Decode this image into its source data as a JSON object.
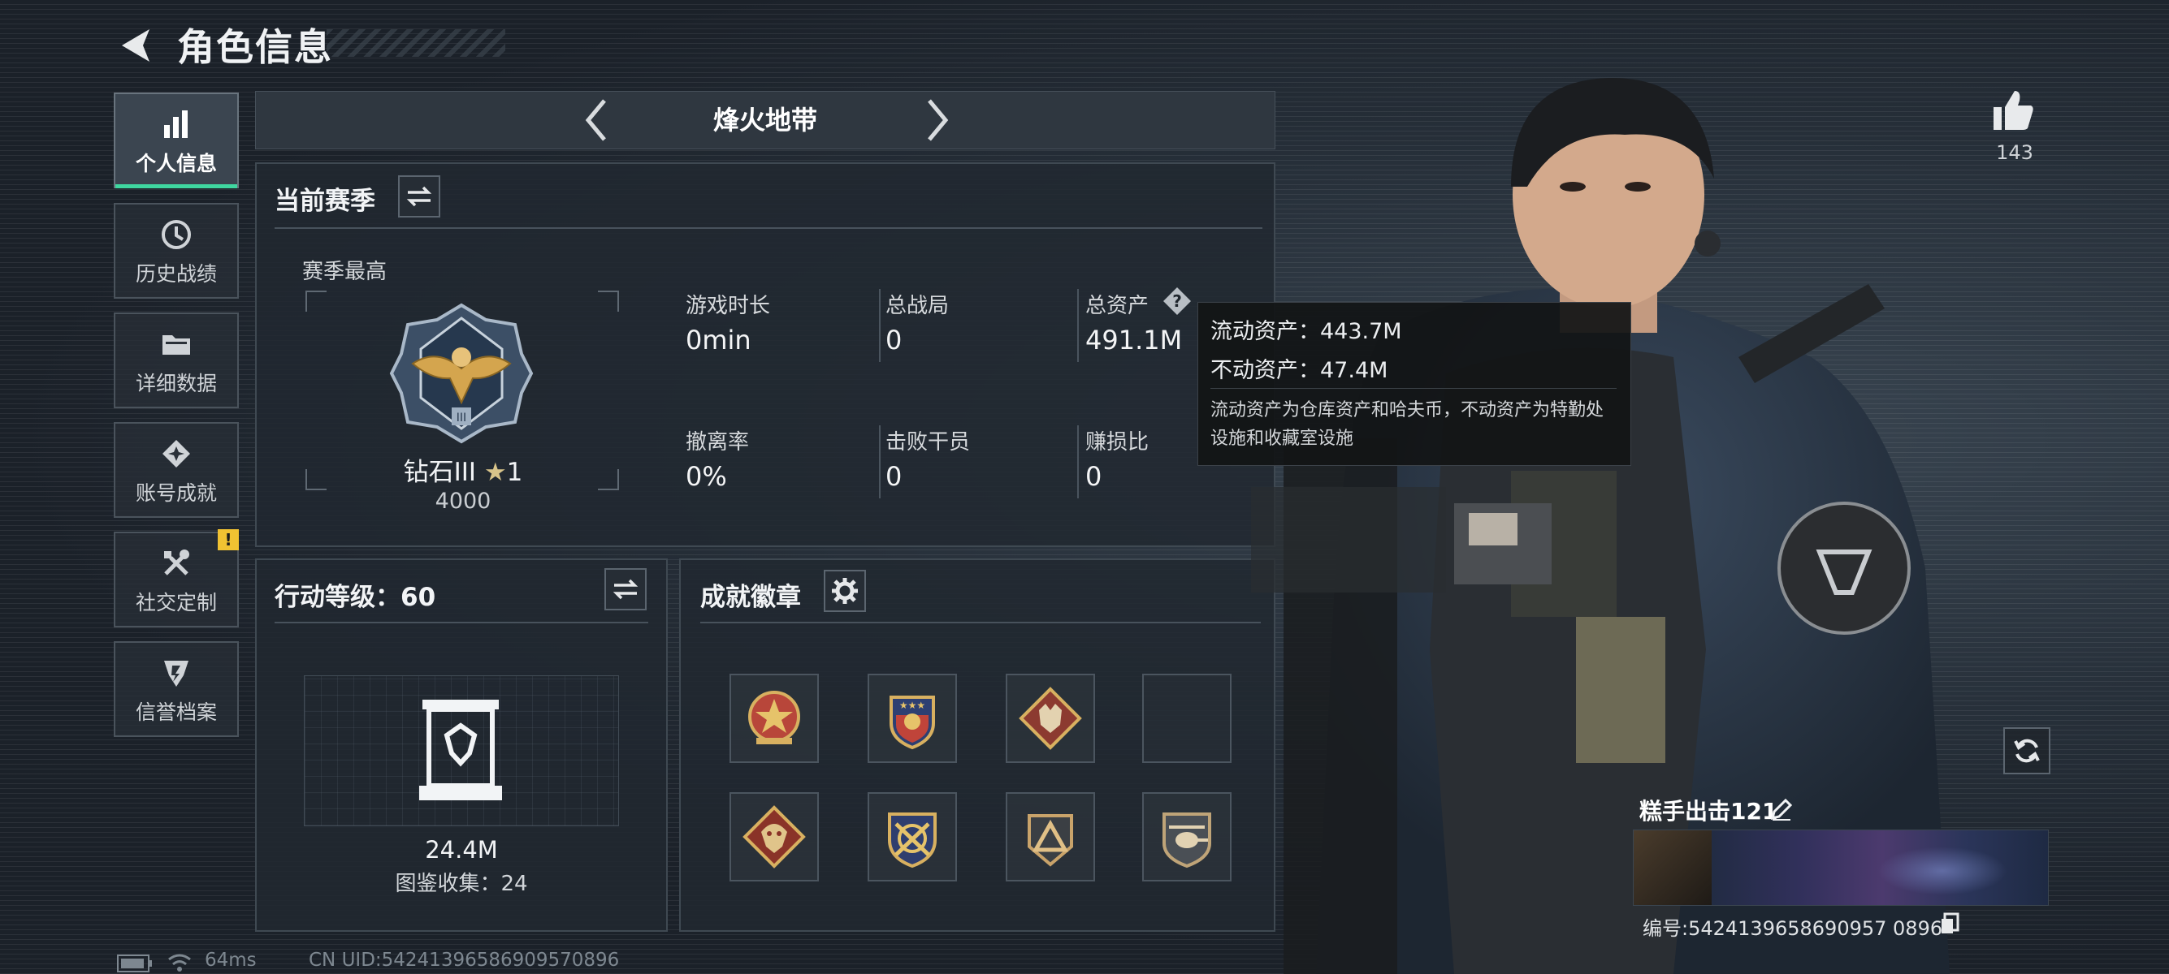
{
  "header": {
    "title": "角色信息"
  },
  "sidebar": {
    "items": [
      {
        "label": "个人信息",
        "icon": "bar-chart-icon",
        "active": true
      },
      {
        "label": "历史战绩",
        "icon": "history-icon"
      },
      {
        "label": "详细数据",
        "icon": "folder-icon"
      },
      {
        "label": "账号成就",
        "icon": "achievement-icon"
      },
      {
        "label": "社交定制",
        "icon": "tools-icon",
        "badge": "!"
      },
      {
        "label": "信誉档案",
        "icon": "reputation-icon"
      }
    ]
  },
  "mode": {
    "title": "烽火地带"
  },
  "season": {
    "title": "当前赛季",
    "best_label": "赛季最高",
    "rank_name": "钻石III",
    "rank_stars": "1",
    "rank_points": "4000",
    "stats": [
      {
        "label": "游戏时长",
        "value": "0min"
      },
      {
        "label": "总战局",
        "value": "0"
      },
      {
        "label": "总资产",
        "value": "491.1M"
      },
      {
        "label": "撤离率",
        "value": "0%"
      },
      {
        "label": "击败干员",
        "value": "0"
      },
      {
        "label": "赚损比",
        "value": "0"
      }
    ]
  },
  "tooltip": {
    "liquid": "流动资产：443.7M",
    "fixed": "不动资产：47.4M",
    "desc": "流动资产为仓库资产和哈夫币，不动资产为特勤处设施和收藏室设施"
  },
  "level": {
    "title": "行动等级：60",
    "value": "24.4M",
    "collection": "图鉴收集：24"
  },
  "badges": {
    "title": "成就徽章",
    "items": [
      "star-shield-badge",
      "eagle-shield-badge",
      "wolf-diamond-badge",
      "empty-slot",
      "dragon-diamond-badge",
      "crossed-weapons-badge",
      "triangle-badge",
      "helicopter-badge"
    ]
  },
  "character": {
    "likes": "143",
    "name": "糕手出击121",
    "id_text": "编号:5424139658690957 0896"
  },
  "status_bar": {
    "ping": "64ms",
    "uid": "CN UID:54241396586909570896"
  },
  "colors": {
    "accent": "#3fd7a0",
    "warning": "#f1c232",
    "background": "#1c232b"
  }
}
